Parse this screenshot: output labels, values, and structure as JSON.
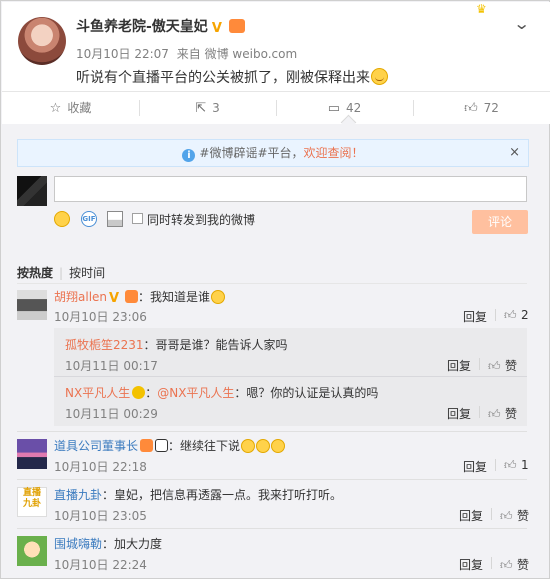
{
  "post": {
    "username": "斗鱼养老院-傲天皇妃",
    "date": "10月10日 22:07",
    "source_prefix": "来自",
    "source": "微博 weibo.com",
    "text": "听说有个直播平台的公关被抓了，刚被保释出来"
  },
  "actions": {
    "favorite": "收藏",
    "repost": "3",
    "comment": "42",
    "like": "72"
  },
  "tip": {
    "prefix": "#微博辟谣#平台，",
    "link": "欢迎查阅！",
    "close": "×"
  },
  "composer": {
    "input_value": "",
    "repost_label": "同时转发到我的微博",
    "submit": "评论"
  },
  "sort": {
    "hot": "按热度",
    "time": "按时间"
  },
  "comments": [
    {
      "user": "胡翔allen",
      "text": "：我知道是谁",
      "time": "10月10日 23:06",
      "reply": "回复",
      "likes": "2",
      "replies": [
        {
          "user": "孤牧栀笙2231",
          "text": "：哥哥是谁？能告诉人家吗",
          "time": "10月11日 00:17",
          "reply": "回复",
          "likes": "赞"
        },
        {
          "user": "NX平凡人生",
          "mention": "@NX平凡人生",
          "text": "：嗯？你的认证是认真的吗",
          "time": "10月11日 00:29",
          "reply": "回复",
          "likes": "赞"
        }
      ]
    },
    {
      "user": "道具公司董事长",
      "text": "：继续往下说",
      "time": "10月10日 22:18",
      "reply": "回复",
      "likes": "1"
    },
    {
      "user": "直播九卦",
      "text": "：皇妃，把信息再透露一点。我来打听打听。",
      "time": "10月10日 23:05",
      "reply": "回复",
      "likes": "赞"
    },
    {
      "user": "围城嗨勒",
      "text": "：加大力度",
      "time": "10月10日 22:24",
      "reply": "回复",
      "likes": "赞"
    }
  ],
  "icons": {
    "thumb": "thumbs-up-icon",
    "comment": "comment-bubble-icon",
    "repost": "repost-icon",
    "favorite": "star-icon"
  },
  "colors": {
    "accent": "#eb7350",
    "link": "#3b7bbf",
    "submit_disabled": "#ffc09f",
    "tip_bg": "#eaf4ff"
  }
}
